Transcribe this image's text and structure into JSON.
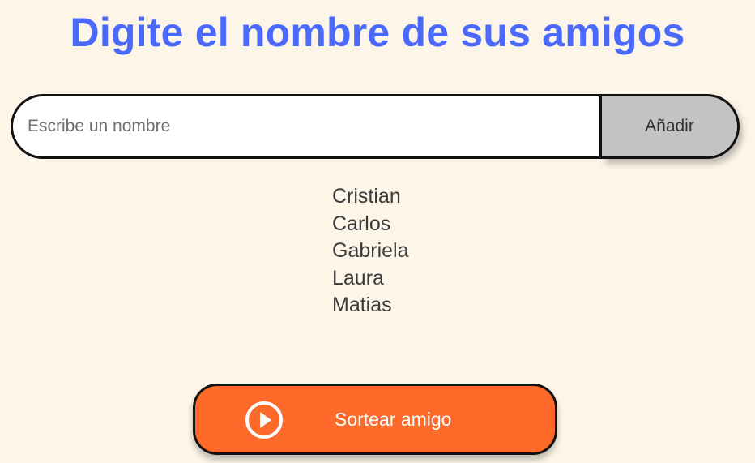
{
  "header": {
    "title": "Digite el nombre de sus amigos"
  },
  "form": {
    "input_placeholder": "Escribe un nombre",
    "input_value": "",
    "add_button_label": "Añadir"
  },
  "friends": [
    "Cristian",
    "Carlos",
    "Gabriela",
    "Laura",
    "Matias"
  ],
  "actions": {
    "draw_button_label": "Sortear amigo",
    "draw_button_icon": "play-circle-icon"
  },
  "colors": {
    "background": "#fdf6e8",
    "title": "#4b69fd",
    "add_button": "#c3c3c3",
    "draw_button": "#ff6a2b"
  }
}
